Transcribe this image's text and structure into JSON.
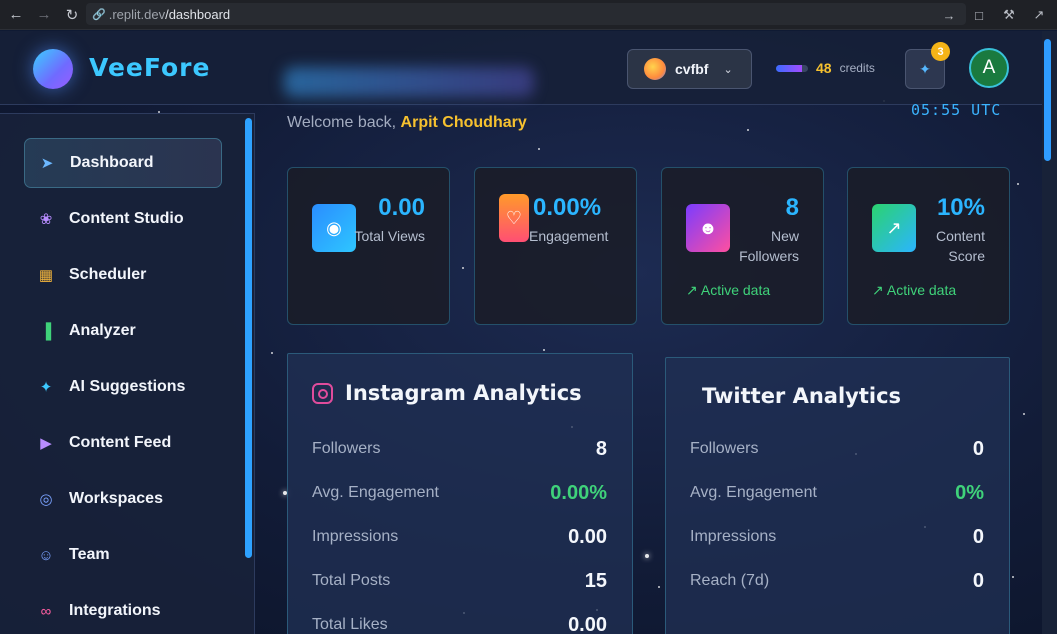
{
  "browser": {
    "url_subdomain": ".replit.dev",
    "url_path": "/dashboard"
  },
  "header": {
    "brand": "VeeFore",
    "workspace_name": "cvfbf",
    "credits_value": "48",
    "credits_label": "credits",
    "credits_fill": 0.8,
    "notification_count": "3",
    "user_initial": "A"
  },
  "sidebar": {
    "items": [
      {
        "label": "Dashboard",
        "icon": "rocket-icon",
        "color": "#6cb8ff"
      },
      {
        "label": "Content Studio",
        "icon": "brain-icon",
        "color": "#b78cff"
      },
      {
        "label": "Scheduler",
        "icon": "calendar-icon",
        "color": "#f6b73c"
      },
      {
        "label": "Analyzer",
        "icon": "bar-chart-icon",
        "color": "#3fd27a"
      },
      {
        "label": "AI Suggestions",
        "icon": "sparkles-icon",
        "color": "#3cc8ff"
      },
      {
        "label": "Content Feed",
        "icon": "play-circle-icon",
        "color": "#b78cff"
      },
      {
        "label": "Workspaces",
        "icon": "globe-icon",
        "color": "#7aa2ff"
      },
      {
        "label": "Team",
        "icon": "users-icon",
        "color": "#7aa2ff"
      },
      {
        "label": "Integrations",
        "icon": "link-icon",
        "color": "#ff5fa2"
      }
    ]
  },
  "main": {
    "welcome_prefix": "Welcome back,",
    "user_name": "Arpit Choudhary",
    "clock": "05:55 UTC",
    "stats": [
      {
        "value": "0.00",
        "label": "Total Views",
        "icon": "eye-icon",
        "active": ""
      },
      {
        "value": "0.00%",
        "label": "Engagement",
        "icon": "heart-icon",
        "active": ""
      },
      {
        "value": "8",
        "label": "New Followers",
        "icon": "users-icon",
        "active": "Active data"
      },
      {
        "value": "10%",
        "label": "Content Score",
        "icon": "trending-up-icon",
        "active": "Active data"
      }
    ],
    "instagram": {
      "title": "Instagram Analytics",
      "metrics": [
        {
          "label": "Followers",
          "value": "8"
        },
        {
          "label": "Avg. Engagement",
          "value": "0.00%"
        },
        {
          "label": "Impressions",
          "value": "0.00"
        },
        {
          "label": "Total Posts",
          "value": "15"
        },
        {
          "label": "Total Likes",
          "value": "0.00"
        }
      ]
    },
    "twitter": {
      "title": "Twitter Analytics",
      "metrics": [
        {
          "label": "Followers",
          "value": "0"
        },
        {
          "label": "Avg. Engagement",
          "value": "0%"
        },
        {
          "label": "Impressions",
          "value": "0"
        },
        {
          "label": "Reach (7d)",
          "value": "0"
        }
      ]
    }
  },
  "colors": {
    "accent": "#2bb5ff",
    "gold": "#f6c12f",
    "green": "#3fd27a"
  }
}
